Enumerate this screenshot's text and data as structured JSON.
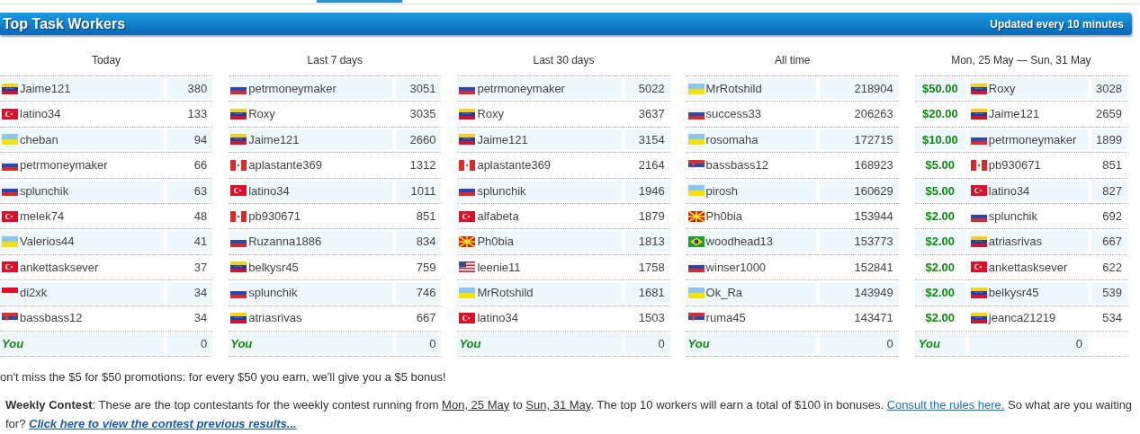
{
  "header": {
    "title": "Top Task Workers",
    "note": "Updated every 10 minutes"
  },
  "boards": [
    {
      "title": "Today",
      "you": {
        "label": "You",
        "score": "0"
      },
      "rows": [
        {
          "kind": "ve",
          "name": "Jaime121",
          "score": "380"
        },
        {
          "kind": "tr",
          "name": "latino34",
          "score": "133"
        },
        {
          "kind": "ua",
          "name": "cheban",
          "score": "94"
        },
        {
          "kind": "ru",
          "name": "petrmoneymaker",
          "score": "66"
        },
        {
          "kind": "ru",
          "name": "splunchik",
          "score": "63"
        },
        {
          "kind": "tr",
          "name": "melek74",
          "score": "48"
        },
        {
          "kind": "ua",
          "name": "Valerios44",
          "score": "41"
        },
        {
          "kind": "tr",
          "name": "ankettasksever",
          "score": "37"
        },
        {
          "kind": "id",
          "name": "di2xk",
          "score": "34"
        },
        {
          "kind": "rs",
          "name": "bassbass12",
          "score": "34"
        }
      ]
    },
    {
      "title": "Last 7 days",
      "you": {
        "label": "You",
        "score": "0"
      },
      "rows": [
        {
          "kind": "ru",
          "name": "petrmoneymaker",
          "score": "3051"
        },
        {
          "kind": "ve",
          "name": "Roxy",
          "score": "3035"
        },
        {
          "kind": "ve",
          "name": "Jaime121",
          "score": "2660"
        },
        {
          "kind": "pe",
          "name": "aplastante369",
          "score": "1312"
        },
        {
          "kind": "tr",
          "name": "latino34",
          "score": "1011"
        },
        {
          "kind": "pe",
          "name": "pb930671",
          "score": "851"
        },
        {
          "kind": "ru",
          "name": "Ruzanna1886",
          "score": "834"
        },
        {
          "kind": "ve",
          "name": "belkysr45",
          "score": "759"
        },
        {
          "kind": "ru",
          "name": "splunchik",
          "score": "746"
        },
        {
          "kind": "ve",
          "name": "atriasrivas",
          "score": "667"
        }
      ]
    },
    {
      "title": "Last 30 days",
      "you": {
        "label": "You",
        "score": "0"
      },
      "rows": [
        {
          "kind": "ru",
          "name": "petrmoneymaker",
          "score": "5022"
        },
        {
          "kind": "ve",
          "name": "Roxy",
          "score": "3637"
        },
        {
          "kind": "ve",
          "name": "Jaime121",
          "score": "3154"
        },
        {
          "kind": "pe",
          "name": "aplastante369",
          "score": "2164"
        },
        {
          "kind": "ru",
          "name": "splunchik",
          "score": "1946"
        },
        {
          "kind": "tr",
          "name": "alfabeta",
          "score": "1879"
        },
        {
          "kind": "mk",
          "name": "Ph0bia",
          "score": "1813"
        },
        {
          "kind": "us",
          "name": "leenie11",
          "score": "1758"
        },
        {
          "kind": "ua",
          "name": "MrRotshild",
          "score": "1681"
        },
        {
          "kind": "tr",
          "name": "latino34",
          "score": "1503"
        }
      ]
    },
    {
      "title": "All time",
      "you": {
        "label": "You",
        "score": "0"
      },
      "rows": [
        {
          "kind": "ua",
          "name": "MrRotshild",
          "score": "218904"
        },
        {
          "kind": "ru",
          "name": "success33",
          "score": "206263"
        },
        {
          "kind": "ua",
          "name": "rosomaha",
          "score": "172715"
        },
        {
          "kind": "rs",
          "name": "bassbass12",
          "score": "168923"
        },
        {
          "kind": "ua",
          "name": "pirosh",
          "score": "160629"
        },
        {
          "kind": "mk",
          "name": "Ph0bia",
          "score": "153944"
        },
        {
          "kind": "br",
          "name": "woodhead13",
          "score": "153773"
        },
        {
          "kind": "ru",
          "name": "winser1000",
          "score": "152841"
        },
        {
          "kind": "ua",
          "name": "Ok_Ra",
          "score": "143949"
        },
        {
          "kind": "rs",
          "name": "ruma45",
          "score": "143471"
        }
      ]
    },
    {
      "title": "Mon, 25 May — Sun, 31 May",
      "you": {
        "label": "You",
        "score": "0"
      },
      "rows": [
        {
          "prize": "$50.00",
          "kind": "ve",
          "name": "Roxy",
          "score": "3028"
        },
        {
          "prize": "$20.00",
          "kind": "ve",
          "name": "Jaime121",
          "score": "2659"
        },
        {
          "prize": "$10.00",
          "kind": "ru",
          "name": "petrmoneymaker",
          "score": "1899"
        },
        {
          "prize": "$5.00",
          "kind": "pe",
          "name": "pb930671",
          "score": "851"
        },
        {
          "prize": "$5.00",
          "kind": "tr",
          "name": "latino34",
          "score": "827"
        },
        {
          "prize": "$2.00",
          "kind": "ru",
          "name": "splunchik",
          "score": "692"
        },
        {
          "prize": "$2.00",
          "kind": "ve",
          "name": "atriasrivas",
          "score": "667"
        },
        {
          "prize": "$2.00",
          "kind": "tr",
          "name": "ankettasksever",
          "score": "622"
        },
        {
          "prize": "$2.00",
          "kind": "ve",
          "name": "belkysr45",
          "score": "539"
        },
        {
          "prize": "$2.00",
          "kind": "ve",
          "name": "jeanca21219",
          "score": "534"
        }
      ]
    }
  ],
  "promo": "on't miss the $5 for $50 promotions: for every $50 you earn, we'll give you a $5 bonus!",
  "contest": {
    "label": "Weekly Contest",
    "text_1": ": These are the top contestants for the weekly contest running from ",
    "start_date": "Mon, 25 May",
    "text_2": " to ",
    "end_date": "Sun, 31 May",
    "text_3": ". The top 10 workers will earn a total of $100 in bonuses. ",
    "rules_link": "Consult the rules here.",
    "text_4": " So what are you waiting for? ",
    "results_link": "Click here to view the contest previous results..."
  }
}
